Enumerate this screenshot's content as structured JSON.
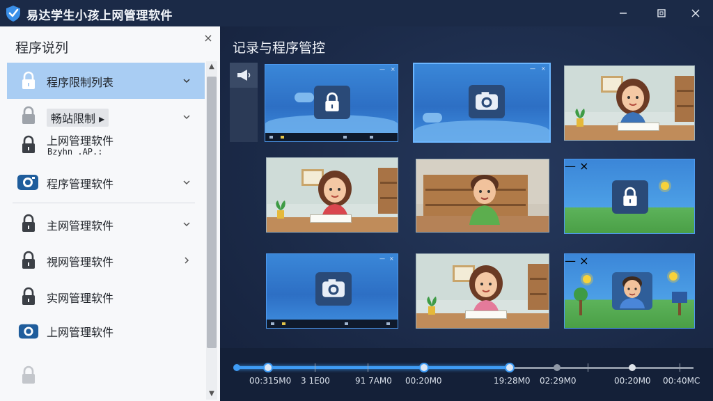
{
  "window": {
    "title": "易达学生小孩上网管理软件",
    "logo_icon": "shield-check-icon",
    "controls": {
      "minimize": "minimize-icon",
      "maximize": "maximize-icon",
      "close": "close-icon"
    }
  },
  "sidebar": {
    "header": "程序说列",
    "close_glyph": "×",
    "items": [
      {
        "label": "程序限制列表",
        "icon": "lock-icon",
        "chevron": "chevron-down",
        "active": true
      },
      {
        "label": "畅站限制",
        "icon": "lock-icon",
        "chevron": "chevron-down",
        "tag_suffix": "▸"
      },
      {
        "label": "上网管理软件",
        "icon": "lock-icon",
        "sub": "Bzyhn .AP.:"
      },
      {
        "label": "程序管理软件",
        "icon": "camera-icon",
        "chevron": "chevron-down"
      },
      {
        "label": "主网管理软件",
        "icon": "lock-icon",
        "chevron": "chevron-down"
      },
      {
        "label": "視网管理软件",
        "icon": "lock-icon",
        "chevron": "chevron-right"
      },
      {
        "label": "实网管理软件",
        "icon": "lock-icon"
      },
      {
        "label": "上网管理软件",
        "icon": "camera-icon"
      },
      {
        "label": "",
        "icon": "lock-icon"
      }
    ],
    "scroll": {
      "up_glyph": "▲",
      "down_glyph": "▼"
    }
  },
  "main": {
    "title": "记录与程序管控",
    "tool_icon": "megaphone-icon",
    "tiles": [
      {
        "kind": "lock",
        "selected": false
      },
      {
        "kind": "camera",
        "selected": true
      },
      {
        "kind": "girl"
      },
      {
        "kind": "girl"
      },
      {
        "kind": "boy"
      },
      {
        "kind": "outdoor-lock"
      },
      {
        "kind": "camera"
      },
      {
        "kind": "girl"
      },
      {
        "kind": "outdoor-boy"
      }
    ],
    "window_glyphs": {
      "min": "—",
      "close": "×"
    }
  },
  "timeline": {
    "progress": 0.6,
    "labels": [
      "00:315M0",
      "3 1E00",
      "91 7AM0",
      "00:20M0",
      "19:28M0",
      "02:29M0",
      "00:20M0",
      "00:40MC"
    ],
    "colors": {
      "active": "#3f9cf5",
      "inactive": "#8f98a6"
    }
  },
  "colors": {
    "titlebar": "#1b2a47",
    "sidebar_active": "#a9cdf3",
    "main_bg": "#1b2a48",
    "tile_blue": "#2d6fc4"
  }
}
